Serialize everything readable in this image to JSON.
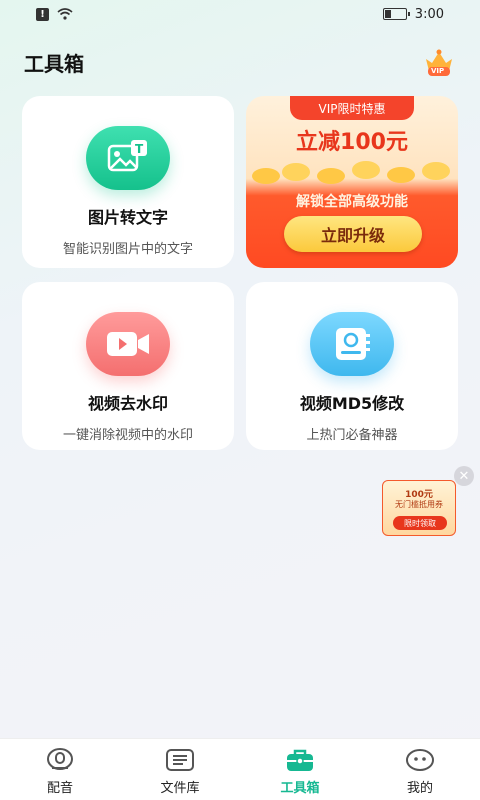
{
  "status": {
    "time": "3:00"
  },
  "header": {
    "title": "工具箱",
    "vip_badge_text": "VIP"
  },
  "tools": [
    {
      "title": "图片转文字",
      "subtitle": "智能识别图片中的文字",
      "icon": "image-text-icon",
      "color": "#2fd3a0"
    },
    {
      "title": "视频去水印",
      "subtitle": "一键消除视频中的水印",
      "icon": "video-camera-icon",
      "color": "#f97d7d"
    },
    {
      "title": "视频MD5修改",
      "subtitle": "上热门必备神器",
      "icon": "md5-device-icon",
      "color": "#57c8f5"
    }
  ],
  "promo": {
    "tag": "VIP限时特惠",
    "amount": "立减100元",
    "desc": "解锁全部高级功能",
    "button": "立即升级"
  },
  "coupon": {
    "line1": "100元",
    "line2": "无门槛抵用券",
    "button": "限时领取"
  },
  "tabs": [
    {
      "label": "配音",
      "icon": "dubbing-icon"
    },
    {
      "label": "文件库",
      "icon": "file-library-icon"
    },
    {
      "label": "工具箱",
      "icon": "toolbox-icon",
      "active": true
    },
    {
      "label": "我的",
      "icon": "profile-icon"
    }
  ],
  "colors": {
    "accent": "#16b892",
    "promo_red": "#f4442b"
  }
}
